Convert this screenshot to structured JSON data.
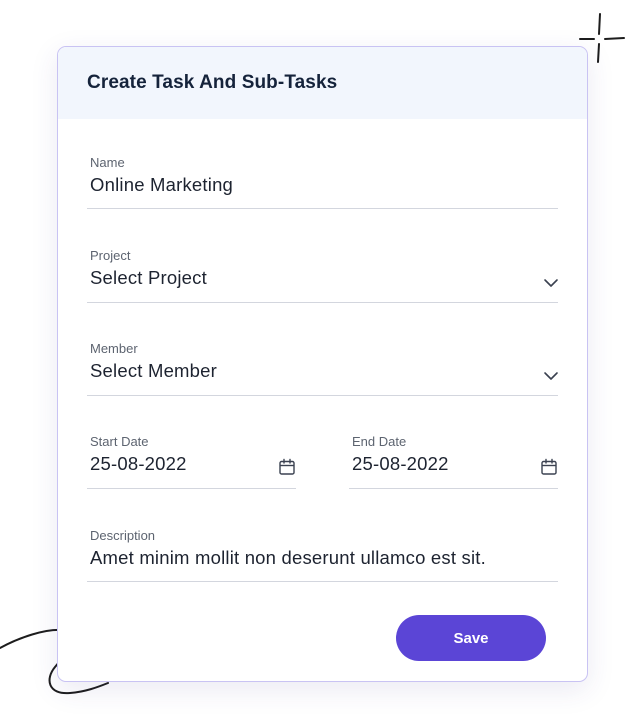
{
  "form": {
    "title": "Create Task And Sub-Tasks",
    "name": {
      "label": "Name",
      "value": "Online Marketing"
    },
    "project": {
      "label": "Project",
      "value": "Select Project",
      "icon": "chevron-down-icon"
    },
    "member": {
      "label": "Member",
      "value": "Select Member",
      "icon": "chevron-down-icon"
    },
    "start_date": {
      "label": "Start Date",
      "value": "25-08-2022",
      "icon": "calendar-icon"
    },
    "end_date": {
      "label": "End Date",
      "value": "25-08-2022",
      "icon": "calendar-icon"
    },
    "description": {
      "label": "Description",
      "value": "Amet minim mollit non deserunt ullamco est sit."
    },
    "save_label": "Save"
  },
  "colors": {
    "accent": "#5b45d6",
    "card_border": "#c9c3f3",
    "header_bg": "#f2f6fd",
    "title_text": "#15233b"
  }
}
